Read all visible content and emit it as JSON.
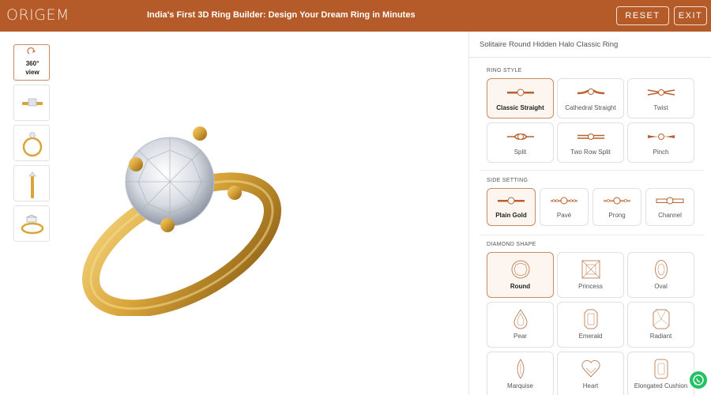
{
  "header": {
    "logo": "ORIGEM",
    "tagline": "India's First 3D Ring Builder: Design Your Dream Ring in Minutes",
    "reset": "RESET",
    "exit": "EXIT"
  },
  "thumbnails": {
    "view360_line1": "360°",
    "view360_line2": "view"
  },
  "panel": {
    "title": "Solitaire Round Hidden Halo Classic Ring",
    "ring_style": {
      "heading": "RING STYLE",
      "options": [
        "Classic Straight",
        "Cathedral Straight",
        "Twist",
        "Split",
        "Two Row Split",
        "Pinch"
      ],
      "selected": "Classic Straight"
    },
    "side_setting": {
      "heading": "SIDE SETTING",
      "options": [
        "Plain Gold",
        "Pavé",
        "Prong",
        "Channel"
      ],
      "selected": "Plain Gold"
    },
    "diamond_shape": {
      "heading": "DIAMOND SHAPE",
      "options": [
        "Round",
        "Princess",
        "Oval",
        "Pear",
        "Emerald",
        "Radiant",
        "Marquise",
        "Heart",
        "Elongated Cushion"
      ],
      "selected": "Round"
    }
  },
  "colors": {
    "brand": "#b55b2a",
    "accent_border": "#c98a66",
    "selected_bg": "#fdf5ef",
    "gold": "#d9a53a",
    "whatsapp": "#25c063"
  },
  "icons": {
    "rotate": "rotate-360-icon",
    "whatsapp": "whatsapp-icon"
  }
}
